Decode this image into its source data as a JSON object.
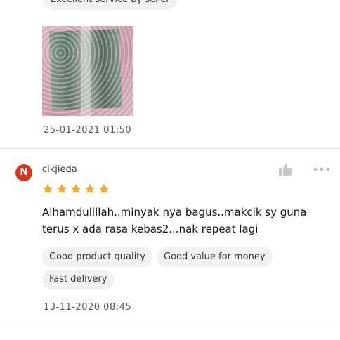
{
  "previous_review": {
    "tag": "Excellent service by seller",
    "photo_description": "",
    "date": "25-01-2021 01:50"
  },
  "review": {
    "avatar_letter": "N",
    "avatar_color": "#d9361e",
    "username": "cikjieda",
    "rating": 5,
    "star_color": "#f5a623",
    "text": "Alhamdulillah..minyak nya bagus..makcik sy guna terus x ada rasa kebas2...nak repeat lagi",
    "tags": [
      "Good product quality",
      "Good value for money",
      "Fast delivery"
    ],
    "date": "13-11-2020 08:45",
    "icons": {
      "like": "thumbs-up-icon",
      "more": "more-options-icon"
    }
  }
}
